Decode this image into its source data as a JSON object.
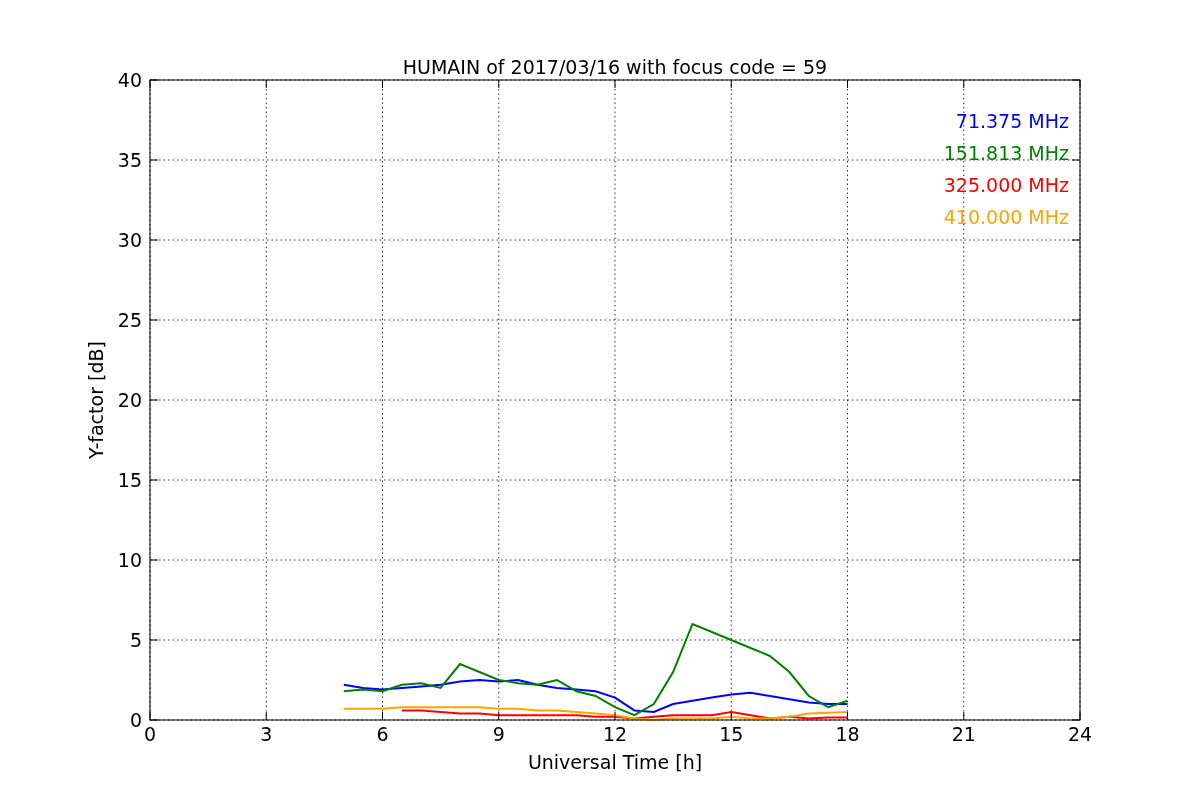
{
  "chart_data": {
    "type": "line",
    "title": "HUMAIN of 2017/03/16 with focus code = 59",
    "xlabel": "Universal Time [h]",
    "ylabel": "Y-factor [dB]",
    "x": [
      5,
      5.5,
      6,
      6.5,
      7,
      7.5,
      8,
      8.5,
      9,
      9.5,
      10,
      10.5,
      11,
      11.5,
      12,
      12.5,
      13,
      13.5,
      14,
      14.5,
      15,
      15.5,
      16,
      16.5,
      17,
      17.5,
      18
    ],
    "series": [
      {
        "name": "71.375 MHz",
        "color": "#0000ff",
        "values": [
          2.2,
          2.0,
          1.9,
          2.0,
          2.1,
          2.2,
          2.4,
          2.5,
          2.4,
          2.5,
          2.2,
          2.0,
          1.9,
          1.8,
          1.4,
          0.6,
          0.5,
          1.0,
          1.2,
          1.4,
          1.6,
          1.7,
          1.5,
          1.3,
          1.1,
          1.0,
          1.0
        ]
      },
      {
        "name": "151.813 MHz",
        "color": "#008000",
        "values": [
          1.8,
          1.9,
          1.8,
          2.2,
          2.3,
          2.0,
          3.5,
          3.0,
          2.5,
          2.3,
          2.2,
          2.5,
          1.8,
          1.5,
          0.8,
          0.3,
          1.0,
          3.0,
          6.0,
          5.5,
          5.0,
          4.5,
          4.0,
          3.0,
          1.5,
          0.8,
          1.2
        ]
      },
      {
        "name": "325.000 MHz",
        "color": "#ff0000",
        "values": [
          null,
          null,
          null,
          0.6,
          0.6,
          0.5,
          0.4,
          0.4,
          0.3,
          0.3,
          0.3,
          0.3,
          0.3,
          0.2,
          0.2,
          0.1,
          0.2,
          0.3,
          0.3,
          0.3,
          0.5,
          0.3,
          0.1,
          0.2,
          0.1,
          0.15,
          0.15
        ]
      },
      {
        "name": "410.000 MHz",
        "color": "#ffa500",
        "values": [
          0.7,
          0.7,
          0.7,
          0.8,
          0.8,
          0.8,
          0.8,
          0.8,
          0.7,
          0.7,
          0.6,
          0.6,
          0.5,
          0.4,
          0.3,
          0.1,
          0.0,
          0.1,
          0.1,
          0.1,
          0.2,
          0.1,
          0.1,
          0.2,
          0.4,
          0.45,
          0.5
        ]
      }
    ],
    "grid": true,
    "xlim": [
      0,
      24
    ],
    "ylim": [
      0,
      40
    ],
    "xticks": [
      0,
      3,
      6,
      9,
      12,
      15,
      18,
      21,
      24
    ],
    "yticks": [
      0,
      5,
      10,
      15,
      20,
      25,
      30,
      35,
      40
    ]
  }
}
